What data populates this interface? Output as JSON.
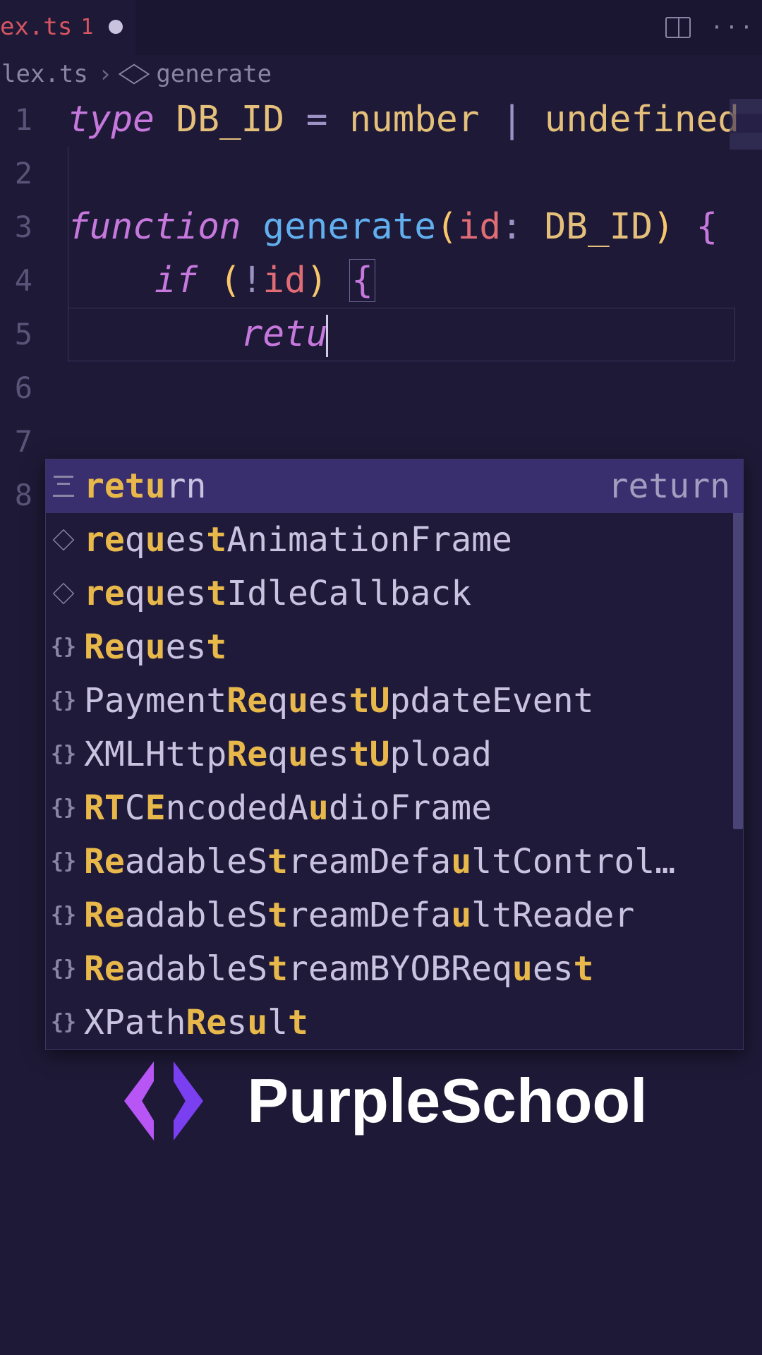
{
  "tab": {
    "filename": "ex.ts",
    "problem_count": "1"
  },
  "breadcrumb": {
    "file": "lex.ts",
    "symbol": "generate"
  },
  "code": {
    "line1": {
      "kw": "type",
      "name": "DB_ID",
      "eq": "=",
      "t1": "number",
      "pipe": "|",
      "t2": "undefined"
    },
    "line3": {
      "kw": "function",
      "name": "generate",
      "param": "id",
      "colon": ":",
      "ptype": "DB_ID"
    },
    "line4": {
      "kw": "if",
      "neg": "!",
      "var": "id"
    },
    "line5": {
      "typed": "retu"
    }
  },
  "line_numbers": [
    "1",
    "2",
    "3",
    "4",
    "5",
    "6",
    "7",
    "8"
  ],
  "autocomplete": {
    "hint": "return",
    "items": [
      {
        "icon": "keyword",
        "segments": [
          [
            "m",
            "retu"
          ],
          [
            "",
            "rn"
          ]
        ]
      },
      {
        "icon": "func",
        "segments": [
          [
            "m",
            "re"
          ],
          [
            "",
            "q"
          ],
          [
            "m",
            "u"
          ],
          [
            "",
            "es"
          ],
          [
            "m",
            "t"
          ],
          [
            "",
            "AnimationFrame"
          ]
        ]
      },
      {
        "icon": "func",
        "segments": [
          [
            "m",
            "re"
          ],
          [
            "",
            "q"
          ],
          [
            "m",
            "u"
          ],
          [
            "",
            "es"
          ],
          [
            "m",
            "t"
          ],
          [
            "",
            "IdleCallback"
          ]
        ]
      },
      {
        "icon": "iface",
        "segments": [
          [
            "m",
            "Re"
          ],
          [
            "",
            "q"
          ],
          [
            "m",
            "u"
          ],
          [
            "",
            "es"
          ],
          [
            "m",
            "t"
          ]
        ]
      },
      {
        "icon": "iface",
        "segments": [
          [
            "",
            "Payment"
          ],
          [
            "m",
            "Re"
          ],
          [
            "",
            "q"
          ],
          [
            "m",
            "u"
          ],
          [
            "",
            "es"
          ],
          [
            "m",
            "t"
          ],
          [
            "m",
            "U"
          ],
          [
            "",
            "pdateEvent"
          ]
        ]
      },
      {
        "icon": "iface",
        "segments": [
          [
            "",
            "XMLHttp"
          ],
          [
            "m",
            "Re"
          ],
          [
            "",
            "q"
          ],
          [
            "m",
            "u"
          ],
          [
            "",
            "es"
          ],
          [
            "m",
            "t"
          ],
          [
            "m",
            "U"
          ],
          [
            "",
            "pload"
          ]
        ]
      },
      {
        "icon": "iface",
        "segments": [
          [
            "m",
            "R"
          ],
          [
            "m",
            "T"
          ],
          [
            "",
            "C"
          ],
          [
            "m",
            "E"
          ],
          [
            "",
            "ncodedA"
          ],
          [
            "m",
            "u"
          ],
          [
            "",
            "dioFrame"
          ]
        ]
      },
      {
        "icon": "iface",
        "segments": [
          [
            "m",
            "R"
          ],
          [
            "m",
            "e"
          ],
          [
            "",
            "adableS"
          ],
          [
            "m",
            "t"
          ],
          [
            "",
            "reamDefa"
          ],
          [
            "m",
            "u"
          ],
          [
            "",
            "ltControl…"
          ]
        ]
      },
      {
        "icon": "iface",
        "segments": [
          [
            "m",
            "R"
          ],
          [
            "m",
            "e"
          ],
          [
            "",
            "adableS"
          ],
          [
            "m",
            "t"
          ],
          [
            "",
            "reamDefa"
          ],
          [
            "m",
            "u"
          ],
          [
            "",
            "ltReader"
          ]
        ]
      },
      {
        "icon": "iface",
        "segments": [
          [
            "m",
            "R"
          ],
          [
            "m",
            "e"
          ],
          [
            "",
            "adableS"
          ],
          [
            "m",
            "t"
          ],
          [
            "",
            "reamBYOBReq"
          ],
          [
            "m",
            "u"
          ],
          [
            "",
            "es"
          ],
          [
            "m",
            "t"
          ]
        ]
      },
      {
        "icon": "iface",
        "segments": [
          [
            "",
            "XPath"
          ],
          [
            "m",
            "R"
          ],
          [
            "m",
            "e"
          ],
          [
            "",
            "s"
          ],
          [
            "m",
            "u"
          ],
          [
            "",
            "l"
          ],
          [
            "m",
            "t"
          ]
        ]
      }
    ]
  },
  "brand": "PurpleSchool"
}
